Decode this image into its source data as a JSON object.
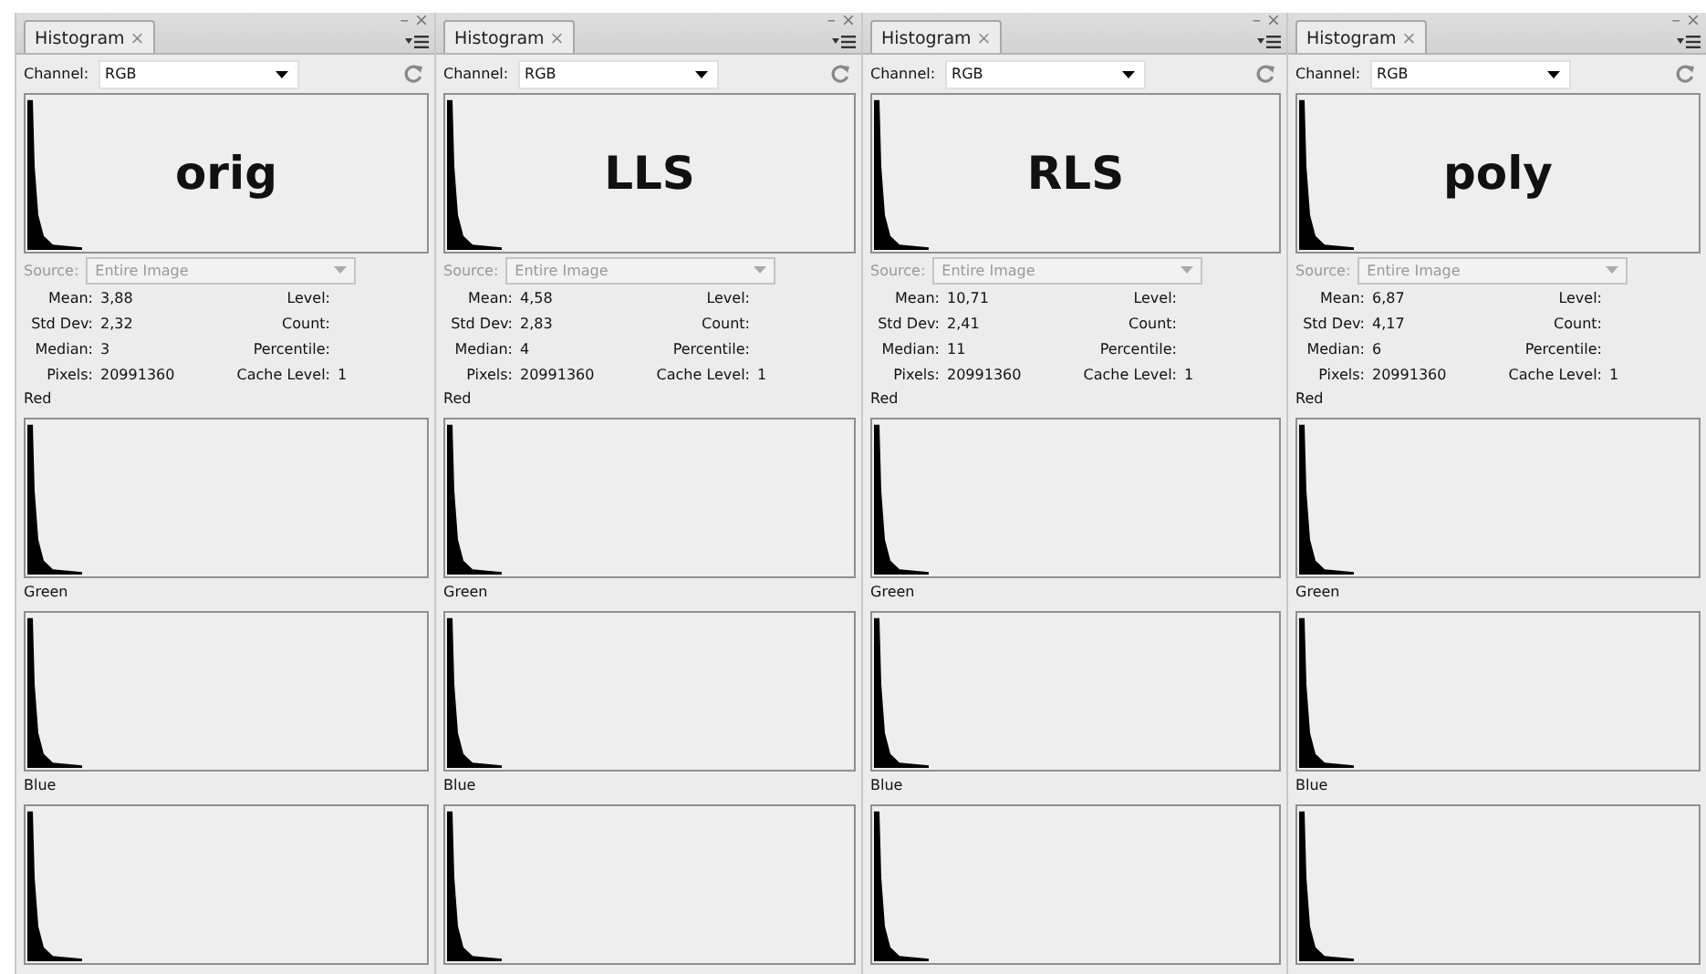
{
  "panels": [
    {
      "tab": "Histogram",
      "tab_close": "×",
      "minimize": "–",
      "close": "×",
      "channel_label": "Channel:",
      "channel": "RGB",
      "overlay": "orig",
      "source": {
        "label": "Source:",
        "value": "Entire Image",
        "disabled": true
      },
      "stats": [
        {
          "label": "Mean:",
          "value": "3,88",
          "label_2": "Level:"
        },
        {
          "label": "Std Dev:",
          "value": "2,32",
          "label_2": "Count:"
        },
        {
          "label": "Median:",
          "value": "3",
          "label_2": "Percentile:"
        },
        {
          "label": "Pixels:",
          "value": "20991360",
          "label_2": "Cache Level:",
          "value_2": "1"
        }
      ],
      "channels": [
        "Red",
        "Green",
        "Blue"
      ]
    },
    {
      "tab": "Histogram",
      "tab_close": "×",
      "minimize": "–",
      "close": "×",
      "channel_label": "Channel:",
      "channel": "RGB",
      "overlay": "LLS",
      "source": {
        "label": "Source:",
        "value": "Entire Image",
        "disabled": true
      },
      "stats": [
        {
          "label": "Mean:",
          "value": "4,58",
          "label_2": "Level:"
        },
        {
          "label": "Std Dev:",
          "value": "2,83",
          "label_2": "Count:"
        },
        {
          "label": "Median:",
          "value": "4",
          "label_2": "Percentile:"
        },
        {
          "label": "Pixels:",
          "value": "20991360",
          "label_2": "Cache Level:",
          "value_2": "1"
        }
      ],
      "channels": [
        "Red",
        "Green",
        "Blue"
      ]
    },
    {
      "tab": "Histogram",
      "tab_close": "×",
      "minimize": "–",
      "close": "×",
      "channel_label": "Channel:",
      "channel": "RGB",
      "overlay": "RLS",
      "source": {
        "label": "Source:",
        "value": "Entire Image",
        "disabled": true
      },
      "stats": [
        {
          "label": "Mean:",
          "value": "10,71",
          "label_2": "Level:"
        },
        {
          "label": "Std Dev:",
          "value": "2,41",
          "label_2": "Count:"
        },
        {
          "label": "Median:",
          "value": "11",
          "label_2": "Percentile:"
        },
        {
          "label": "Pixels:",
          "value": "20991360",
          "label_2": "Cache Level:",
          "value_2": "1"
        }
      ],
      "channels": [
        "Red",
        "Green",
        "Blue"
      ]
    },
    {
      "tab": "Histogram",
      "tab_close": "×",
      "minimize": "–",
      "close": "×",
      "channel_label": "Channel:",
      "channel": "RGB",
      "overlay": "poly",
      "source": {
        "label": "Source:",
        "value": "Entire Image",
        "disabled": true
      },
      "stats": [
        {
          "label": "Mean:",
          "value": "6,87",
          "label_2": "Level:"
        },
        {
          "label": "Std Dev:",
          "value": "4,17",
          "label_2": "Count:"
        },
        {
          "label": "Median:",
          "value": "6",
          "label_2": "Percentile:"
        },
        {
          "label": "Pixels:",
          "value": "20991360",
          "label_2": "Cache Level:",
          "value_2": "1"
        }
      ],
      "channels": [
        "Red",
        "Green",
        "Blue"
      ]
    }
  ]
}
